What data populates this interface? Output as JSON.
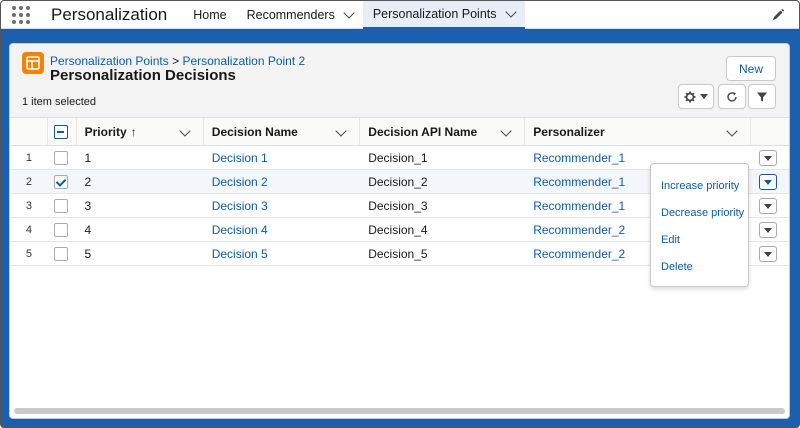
{
  "app": {
    "name": "Personalization"
  },
  "nav": {
    "items": [
      {
        "label": "Home"
      },
      {
        "label": "Recommenders"
      },
      {
        "label": "Personalization Points"
      }
    ]
  },
  "header": {
    "breadcrumb_parent": "Personalization Points",
    "breadcrumb_separator": ">",
    "breadcrumb_current": "Personalization Point 2",
    "title": "Personalization Decisions",
    "selection_status": "1 item selected",
    "new_button": "New"
  },
  "table": {
    "columns": [
      "Priority",
      "Decision Name",
      "Decision API Name",
      "Personalizer"
    ],
    "sort_indicator": "↑",
    "rows": [
      {
        "num": "1",
        "priority": "1",
        "name": "Decision 1",
        "api": "Decision_1",
        "personalizer": "Recommender_1",
        "selected": false
      },
      {
        "num": "2",
        "priority": "2",
        "name": "Decision 2",
        "api": "Decision_2",
        "personalizer": "Recommender_1",
        "selected": true
      },
      {
        "num": "3",
        "priority": "3",
        "name": "Decision 3",
        "api": "Decision_3",
        "personalizer": "Recommender_1",
        "selected": false
      },
      {
        "num": "4",
        "priority": "4",
        "name": "Decision 4",
        "api": "Decision_4",
        "personalizer": "Recommender_2",
        "selected": false
      },
      {
        "num": "5",
        "priority": "5",
        "name": "Decision 5",
        "api": "Decision_5",
        "personalizer": "Recommender_2",
        "selected": false
      }
    ]
  },
  "row_menu": {
    "items": [
      "Increase priority",
      "Decrease priority",
      "Edit",
      "Delete"
    ]
  },
  "colors": {
    "background": "#1b5fae",
    "link": "#0b5cab",
    "object_icon": "#f38303"
  }
}
